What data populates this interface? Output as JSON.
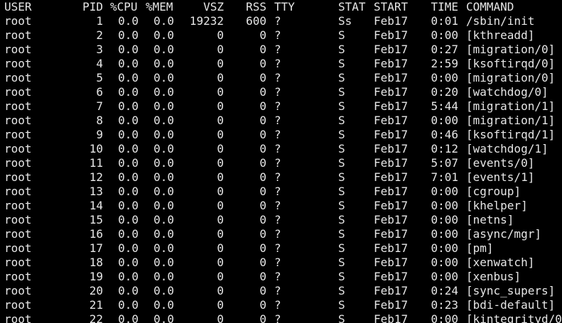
{
  "terminal": {
    "text_color": "#e6e6e6",
    "background_color": "#000000",
    "header": {
      "user": "USER",
      "pid": "PID",
      "cpu": "%CPU",
      "mem": "%MEM",
      "vsz": "VSZ",
      "rss": "RSS",
      "tty": "TTY",
      "stat": "STAT",
      "start": "START",
      "time": "TIME",
      "command": "COMMAND"
    },
    "rows": [
      {
        "user": "root",
        "pid": "1",
        "cpu": "0.0",
        "mem": "0.0",
        "vsz": "19232",
        "rss": "600",
        "tty": "?",
        "stat": "Ss",
        "start": "Feb17",
        "time": "0:01",
        "command": "/sbin/init"
      },
      {
        "user": "root",
        "pid": "2",
        "cpu": "0.0",
        "mem": "0.0",
        "vsz": "0",
        "rss": "0",
        "tty": "?",
        "stat": "S",
        "start": "Feb17",
        "time": "0:00",
        "command": "[kthreadd]"
      },
      {
        "user": "root",
        "pid": "3",
        "cpu": "0.0",
        "mem": "0.0",
        "vsz": "0",
        "rss": "0",
        "tty": "?",
        "stat": "S",
        "start": "Feb17",
        "time": "0:27",
        "command": "[migration/0]"
      },
      {
        "user": "root",
        "pid": "4",
        "cpu": "0.0",
        "mem": "0.0",
        "vsz": "0",
        "rss": "0",
        "tty": "?",
        "stat": "S",
        "start": "Feb17",
        "time": "2:59",
        "command": "[ksoftirqd/0]"
      },
      {
        "user": "root",
        "pid": "5",
        "cpu": "0.0",
        "mem": "0.0",
        "vsz": "0",
        "rss": "0",
        "tty": "?",
        "stat": "S",
        "start": "Feb17",
        "time": "0:00",
        "command": "[migration/0]"
      },
      {
        "user": "root",
        "pid": "6",
        "cpu": "0.0",
        "mem": "0.0",
        "vsz": "0",
        "rss": "0",
        "tty": "?",
        "stat": "S",
        "start": "Feb17",
        "time": "0:20",
        "command": "[watchdog/0]"
      },
      {
        "user": "root",
        "pid": "7",
        "cpu": "0.0",
        "mem": "0.0",
        "vsz": "0",
        "rss": "0",
        "tty": "?",
        "stat": "S",
        "start": "Feb17",
        "time": "5:44",
        "command": "[migration/1]"
      },
      {
        "user": "root",
        "pid": "8",
        "cpu": "0.0",
        "mem": "0.0",
        "vsz": "0",
        "rss": "0",
        "tty": "?",
        "stat": "S",
        "start": "Feb17",
        "time": "0:00",
        "command": "[migration/1]"
      },
      {
        "user": "root",
        "pid": "9",
        "cpu": "0.0",
        "mem": "0.0",
        "vsz": "0",
        "rss": "0",
        "tty": "?",
        "stat": "S",
        "start": "Feb17",
        "time": "0:46",
        "command": "[ksoftirqd/1]"
      },
      {
        "user": "root",
        "pid": "10",
        "cpu": "0.0",
        "mem": "0.0",
        "vsz": "0",
        "rss": "0",
        "tty": "?",
        "stat": "S",
        "start": "Feb17",
        "time": "0:12",
        "command": "[watchdog/1]"
      },
      {
        "user": "root",
        "pid": "11",
        "cpu": "0.0",
        "mem": "0.0",
        "vsz": "0",
        "rss": "0",
        "tty": "?",
        "stat": "S",
        "start": "Feb17",
        "time": "5:07",
        "command": "[events/0]"
      },
      {
        "user": "root",
        "pid": "12",
        "cpu": "0.0",
        "mem": "0.0",
        "vsz": "0",
        "rss": "0",
        "tty": "?",
        "stat": "S",
        "start": "Feb17",
        "time": "7:01",
        "command": "[events/1]"
      },
      {
        "user": "root",
        "pid": "13",
        "cpu": "0.0",
        "mem": "0.0",
        "vsz": "0",
        "rss": "0",
        "tty": "?",
        "stat": "S",
        "start": "Feb17",
        "time": "0:00",
        "command": "[cgroup]"
      },
      {
        "user": "root",
        "pid": "14",
        "cpu": "0.0",
        "mem": "0.0",
        "vsz": "0",
        "rss": "0",
        "tty": "?",
        "stat": "S",
        "start": "Feb17",
        "time": "0:00",
        "command": "[khelper]"
      },
      {
        "user": "root",
        "pid": "15",
        "cpu": "0.0",
        "mem": "0.0",
        "vsz": "0",
        "rss": "0",
        "tty": "?",
        "stat": "S",
        "start": "Feb17",
        "time": "0:00",
        "command": "[netns]"
      },
      {
        "user": "root",
        "pid": "16",
        "cpu": "0.0",
        "mem": "0.0",
        "vsz": "0",
        "rss": "0",
        "tty": "?",
        "stat": "S",
        "start": "Feb17",
        "time": "0:00",
        "command": "[async/mgr]"
      },
      {
        "user": "root",
        "pid": "17",
        "cpu": "0.0",
        "mem": "0.0",
        "vsz": "0",
        "rss": "0",
        "tty": "?",
        "stat": "S",
        "start": "Feb17",
        "time": "0:00",
        "command": "[pm]"
      },
      {
        "user": "root",
        "pid": "18",
        "cpu": "0.0",
        "mem": "0.0",
        "vsz": "0",
        "rss": "0",
        "tty": "?",
        "stat": "S",
        "start": "Feb17",
        "time": "0:00",
        "command": "[xenwatch]"
      },
      {
        "user": "root",
        "pid": "19",
        "cpu": "0.0",
        "mem": "0.0",
        "vsz": "0",
        "rss": "0",
        "tty": "?",
        "stat": "S",
        "start": "Feb17",
        "time": "0:00",
        "command": "[xenbus]"
      },
      {
        "user": "root",
        "pid": "20",
        "cpu": "0.0",
        "mem": "0.0",
        "vsz": "0",
        "rss": "0",
        "tty": "?",
        "stat": "S",
        "start": "Feb17",
        "time": "0:24",
        "command": "[sync_supers]"
      },
      {
        "user": "root",
        "pid": "21",
        "cpu": "0.0",
        "mem": "0.0",
        "vsz": "0",
        "rss": "0",
        "tty": "?",
        "stat": "S",
        "start": "Feb17",
        "time": "0:23",
        "command": "[bdi-default]"
      },
      {
        "user": "root",
        "pid": "22",
        "cpu": "0.0",
        "mem": "0.0",
        "vsz": "0",
        "rss": "0",
        "tty": "?",
        "stat": "S",
        "start": "Feb17",
        "time": "0:00",
        "command": "[kintegrityd/0"
      }
    ]
  }
}
